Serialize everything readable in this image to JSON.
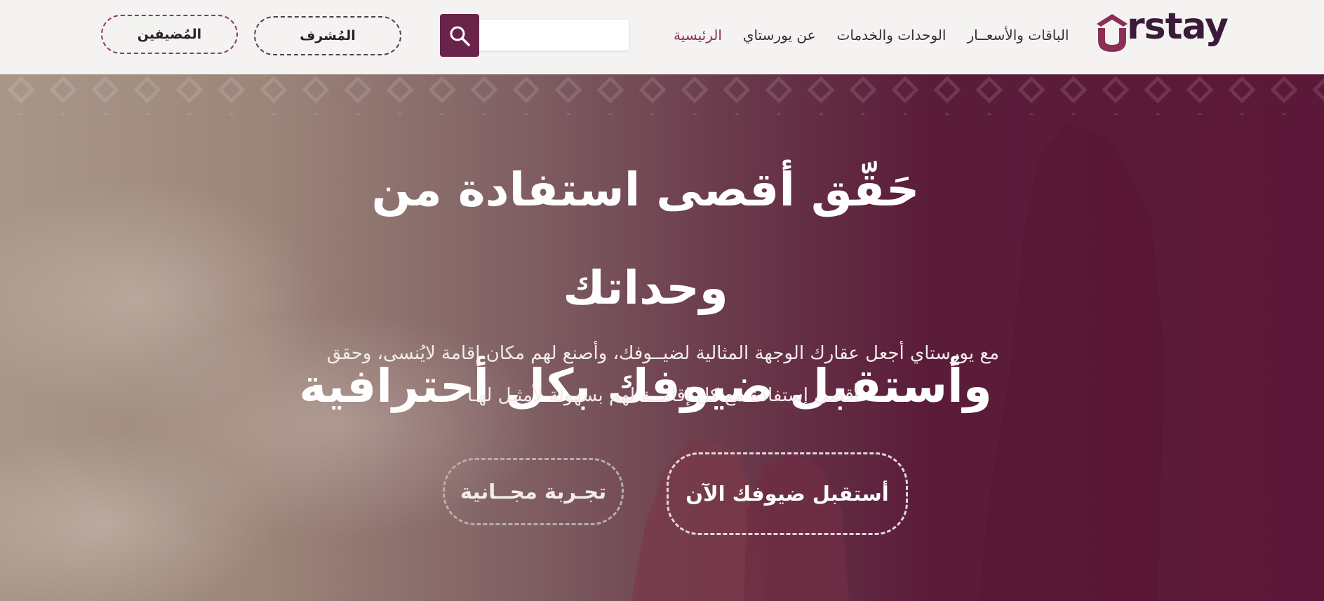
{
  "colors": {
    "brand": "#8b2f55",
    "brand_dark": "#3a1c3a",
    "search_button": "#6a2349",
    "hero_overlay": "#5c1838",
    "header_bg": "#f4f3f2"
  },
  "header": {
    "logo_text": "rstay",
    "nav": [
      {
        "label": "الرئيسية",
        "active": true
      },
      {
        "label": "عن يورستاي"
      },
      {
        "label": "الوحدات والخدمات"
      },
      {
        "label": "الباقات والأسعــار"
      }
    ],
    "search": {
      "placeholder": "",
      "icon": "search-icon"
    },
    "supervisor_label": "المُشرف",
    "hosts_label": "المُضيفين"
  },
  "hero": {
    "headline_line1": "حَقّق أقصى استفادة من وحداتك",
    "headline_line2": "وأستقبل ضيوفك بكل أحترافية",
    "subtitle_line1": "مع يورستاي أجعل عقارك الوجهة المثالية لضيــوفك، وأصنع لهم مكان إقامة لايُنسى، وحقق",
    "subtitle_line2": "أقصى إستفادة مع كل إقامــة لهم بسهولة لأمثيل لهـا",
    "cta_primary": "أستقبل ضيوفك الآن",
    "cta_trial": "تجـربة مجــانية"
  }
}
